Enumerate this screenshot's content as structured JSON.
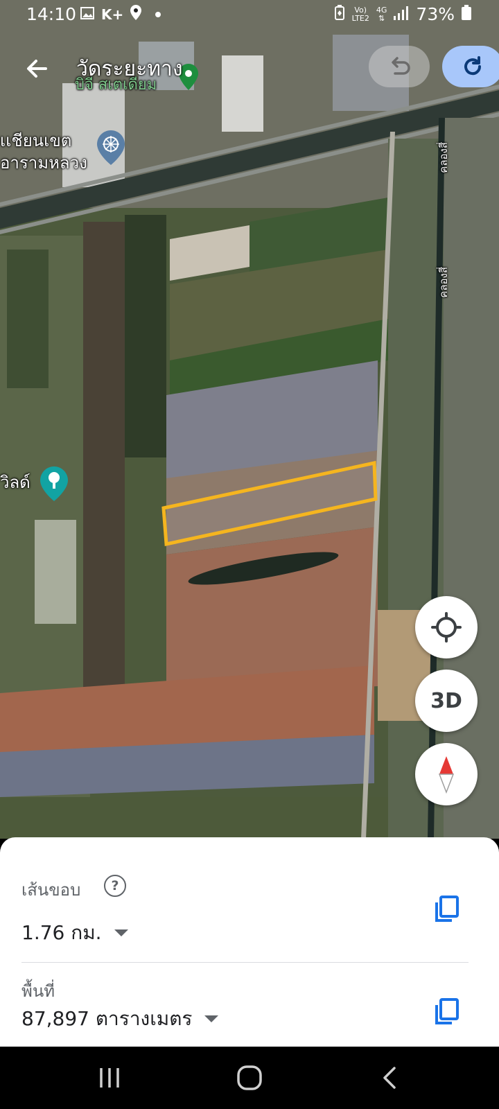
{
  "status_bar": {
    "time": "14:10",
    "carrier_badge": "K+",
    "network_top": "Vo)",
    "network_bottom": "LTE2",
    "network_type": "4G",
    "battery": "73%"
  },
  "header": {
    "title": "วัดระยะทาง",
    "back_icon": "arrow-left-icon",
    "undo_icon": "undo-icon",
    "redo_icon": "redo-icon"
  },
  "map": {
    "labels": {
      "place_1": "บิจี สเตเดียม",
      "place_2_line1": "เเชียนเขต",
      "place_2_line2": "อารามหลวง",
      "place_3": "วิลด์",
      "canal_1": "คลองสี่",
      "canal_2": "คลองสี่"
    },
    "polygon_color": "#f5b51f"
  },
  "map_controls": {
    "locate_icon": "my-location-icon",
    "three_d_label": "3D",
    "compass_icon": "compass-icon"
  },
  "measurement": {
    "perimeter_label": "เส้นขอบ",
    "perimeter_value": "1.76 กม.",
    "area_label": "พื้นที่",
    "area_value": "87,897 ตารางเมตร",
    "help_icon": "help-icon",
    "copy_icon": "copy-icon"
  },
  "nav_bar": {
    "recents_icon": "recents-icon",
    "home_icon": "home-icon",
    "back_icon": "back-icon"
  }
}
